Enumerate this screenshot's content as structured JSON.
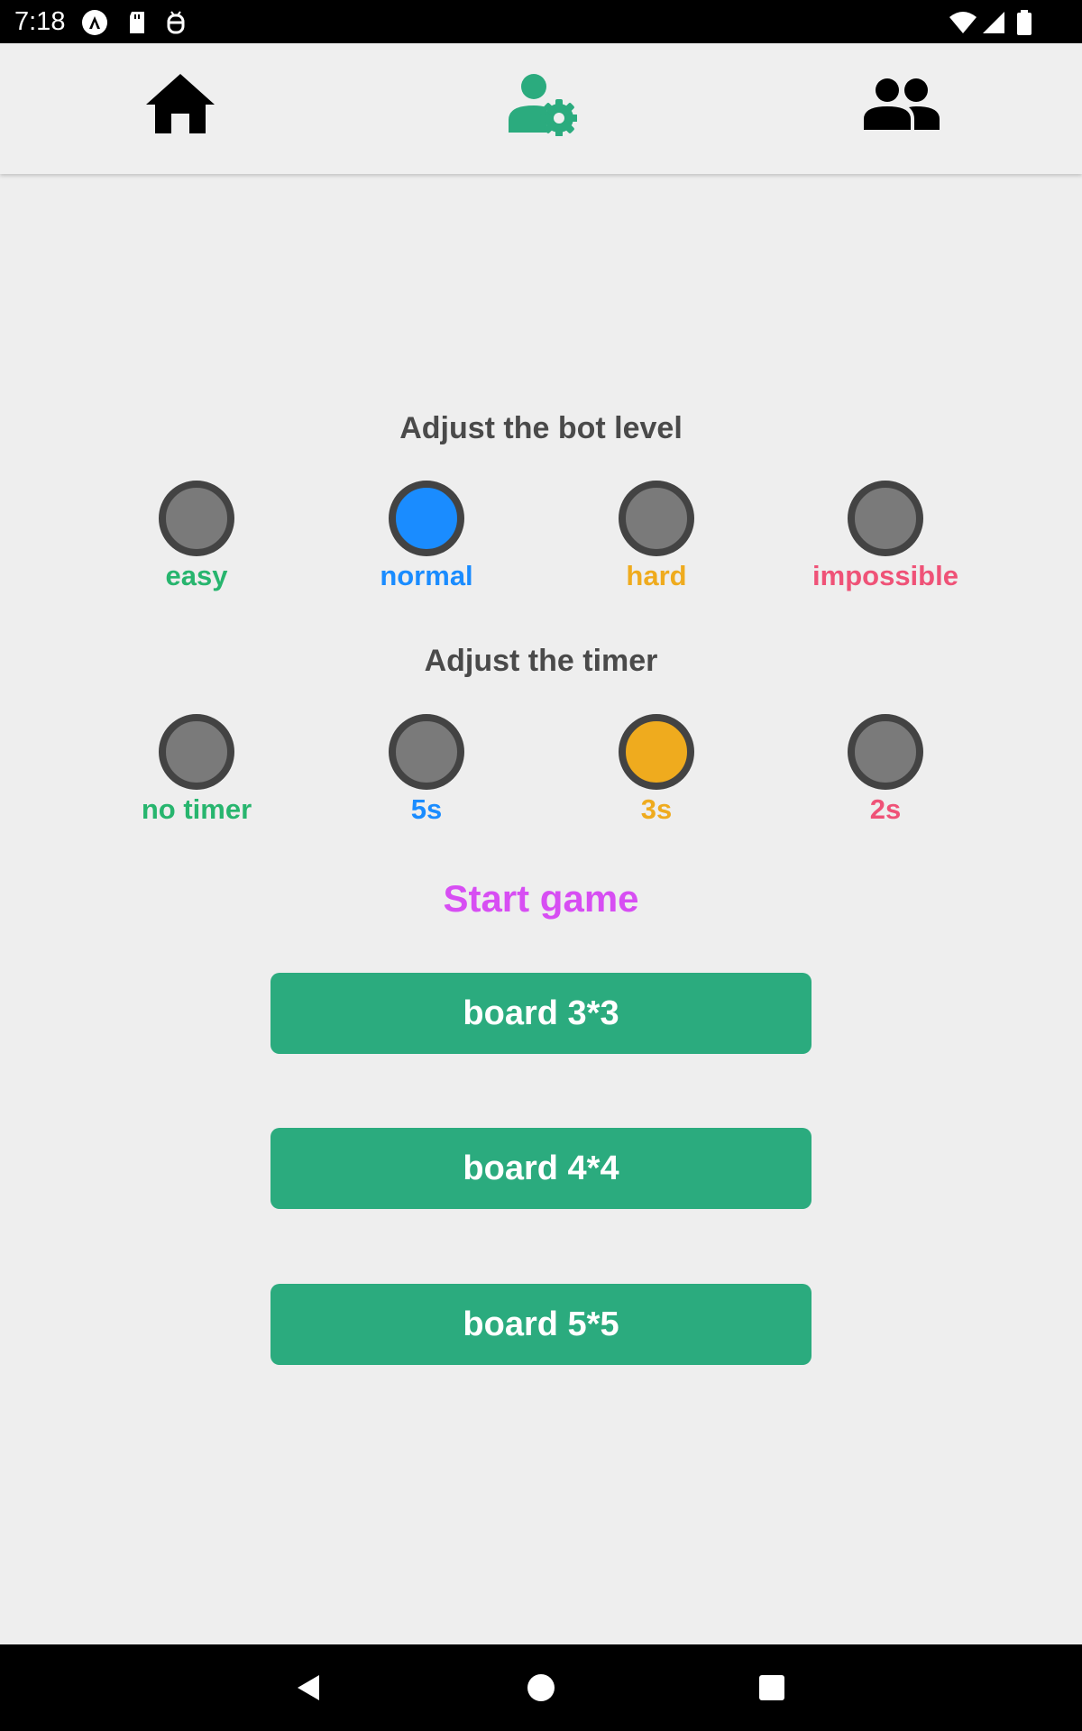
{
  "status_bar": {
    "time": "7:18",
    "icons": [
      "app-a-icon",
      "sd-card-icon",
      "debug-icon",
      "wifi-icon",
      "signal-icon",
      "battery-icon"
    ]
  },
  "top_nav": {
    "items": [
      {
        "name": "home-icon",
        "active": false
      },
      {
        "name": "user-settings-icon",
        "active": true
      },
      {
        "name": "group-icon",
        "active": false
      }
    ],
    "active_color": "#2bab7e",
    "inactive_color": "#000000"
  },
  "bot_level": {
    "title": "Adjust the bot level",
    "options": [
      {
        "label": "easy",
        "color": "#27b56e",
        "selected": false
      },
      {
        "label": "normal",
        "color": "#1a8cff",
        "selected": true
      },
      {
        "label": "hard",
        "color": "#efab1e",
        "selected": false
      },
      {
        "label": "impossible",
        "color": "#ef5277",
        "selected": false
      }
    ]
  },
  "timer": {
    "title": "Adjust the timer",
    "options": [
      {
        "label": "no timer",
        "color": "#27b56e",
        "selected": false
      },
      {
        "label": "5s",
        "color": "#1a8cff",
        "selected": false
      },
      {
        "label": "3s",
        "color": "#efab1e",
        "selected": true
      },
      {
        "label": "2s",
        "color": "#ef5277",
        "selected": false
      }
    ]
  },
  "start": {
    "title": "Start game",
    "color": "#d74ef3",
    "buttons": [
      "board 3*3",
      "board 4*4",
      "board 5*5"
    ],
    "button_color": "#2bab7e"
  },
  "system_nav": {
    "icons": [
      "back-icon",
      "home-circle-icon",
      "recents-icon"
    ]
  }
}
